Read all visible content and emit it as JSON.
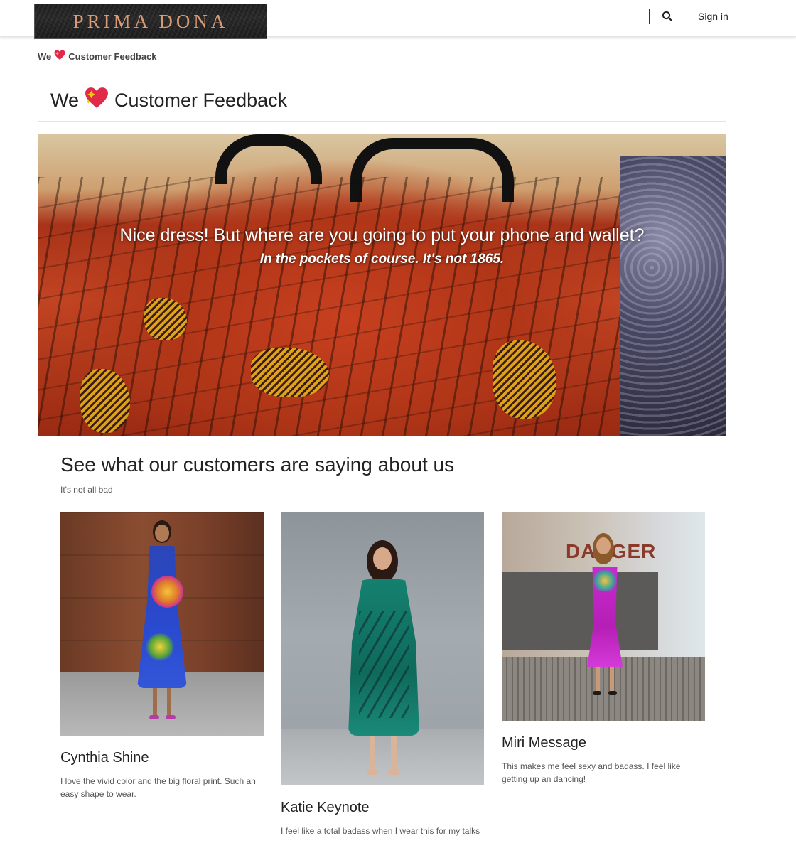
{
  "header": {
    "logo_text": "PRIMA DONA",
    "signin_label": "Sign in",
    "search_icon": "search-icon"
  },
  "breadcrumb": {
    "prefix": "We",
    "heart_icon": "heart-icon",
    "suffix": "Customer Feedback"
  },
  "page": {
    "title_prefix": "We",
    "title_suffix": "Customer Feedback"
  },
  "hero": {
    "headline": "Nice dress! But where are you going to put your phone and wallet?",
    "subline": "In the pockets of course. It's not 1865."
  },
  "section": {
    "title": "See what our customers are saying about us",
    "subtitle": "It's not all bad"
  },
  "testimonials": [
    {
      "name": "Cynthia Shine",
      "text": "I love the vivid color and the big floral print. Such an easy shape to wear."
    },
    {
      "name": "Katie Keynote",
      "text": "I feel like a total badass when I wear this for my talks"
    },
    {
      "name": "Miri Message",
      "text": "This makes me feel sexy and badass. I feel like getting up an dancing!",
      "photo_sign": "DANGER"
    }
  ],
  "colors": {
    "logo_text": "#d99b77",
    "heart": "#e02a4a",
    "sparkle": "#f5c518"
  }
}
